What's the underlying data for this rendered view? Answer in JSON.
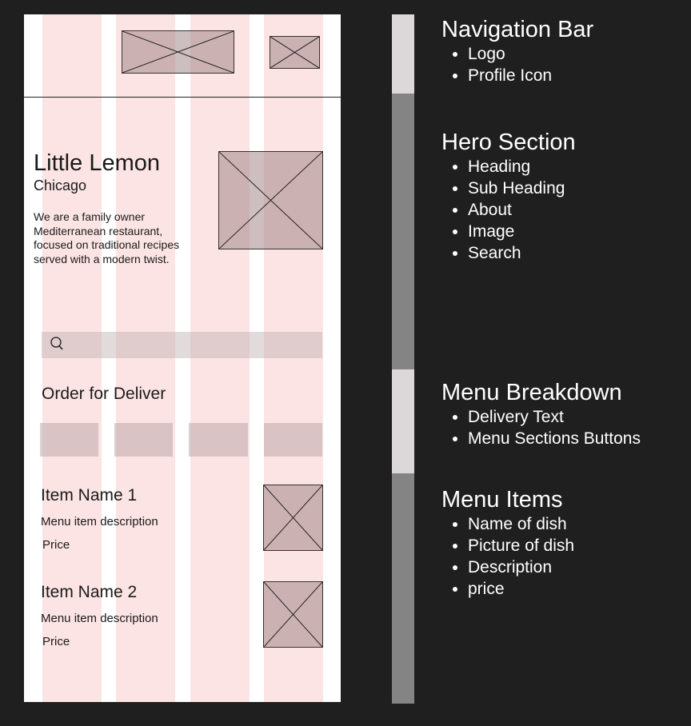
{
  "wireframe": {
    "colors": {
      "background": "#1f1f1f",
      "frame": "#ffffff",
      "grid_column": "#fde4e4",
      "placeholder": "#c4adb0"
    },
    "hero": {
      "heading": "Little Lemon",
      "subheading": "Chicago",
      "about": "We are a family owner Mediterranean restaurant, focused on traditional recipes served with a modern twist."
    },
    "search_icon": "search-icon",
    "menu": {
      "order_title": "Order for Deliver"
    },
    "items": [
      {
        "name": "Item Name 1",
        "description": "Menu item description",
        "price": "Price"
      },
      {
        "name": "Item Name 2",
        "description": "Menu item description",
        "price": "Price"
      }
    ]
  },
  "legend": [
    {
      "title": "Navigation Bar",
      "items": [
        "Logo",
        "Profile Icon"
      ],
      "bar_color": "#dcd8d9"
    },
    {
      "title": "Hero Section",
      "items": [
        "Heading",
        "Sub Heading",
        "About",
        "Image",
        "Search"
      ],
      "bar_color": "#848484"
    },
    {
      "title": "Menu Breakdown",
      "items": [
        "Delivery Text",
        "Menu Sections Buttons"
      ],
      "bar_color": "#dcd8d9"
    },
    {
      "title": "Menu Items",
      "items": [
        "Name of dish",
        "Picture of dish",
        "Description",
        "price"
      ],
      "bar_color": "#848484"
    }
  ]
}
